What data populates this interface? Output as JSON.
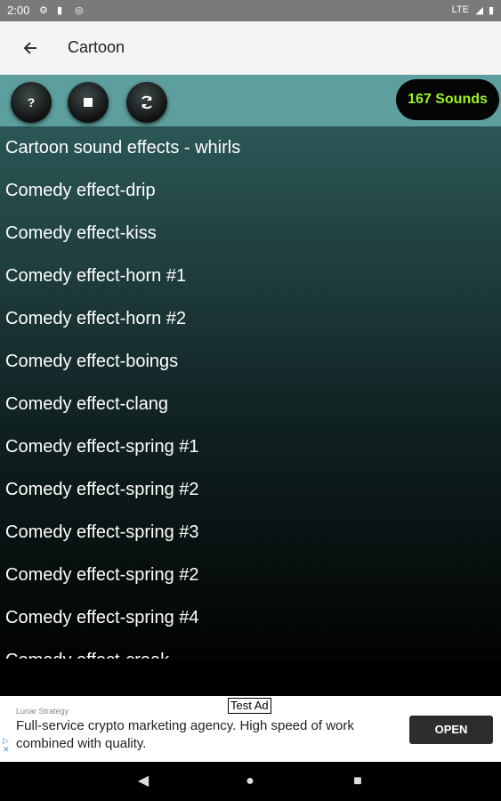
{
  "status_bar": {
    "time": "2:00",
    "network": "LTE"
  },
  "app_bar": {
    "title": "Cartoon"
  },
  "toolbar": {
    "help_label": "?",
    "sound_count": "167 Sounds"
  },
  "sounds": [
    "Cartoon sound effects - whirls",
    "Comedy effect-drip",
    "Comedy effect-kiss",
    "Comedy effect-horn #1",
    "Comedy effect-horn #2",
    "Comedy effect-boings",
    "Comedy effect-clang",
    "Comedy effect-spring #1",
    "Comedy effect-spring #2",
    "Comedy effect-spring #3",
    "Comedy effect-spring #2",
    "Comedy effect-spring #4",
    "Comedy effect-creak"
  ],
  "ad": {
    "badge": "Test Ad",
    "advertiser": "Lunar Strategy",
    "text": "Full-service crypto marketing agency. High speed of work combined with quality.",
    "cta": "OPEN"
  },
  "colors": {
    "toolbar": "#5d9e9e",
    "count_text": "#9cf21f"
  }
}
